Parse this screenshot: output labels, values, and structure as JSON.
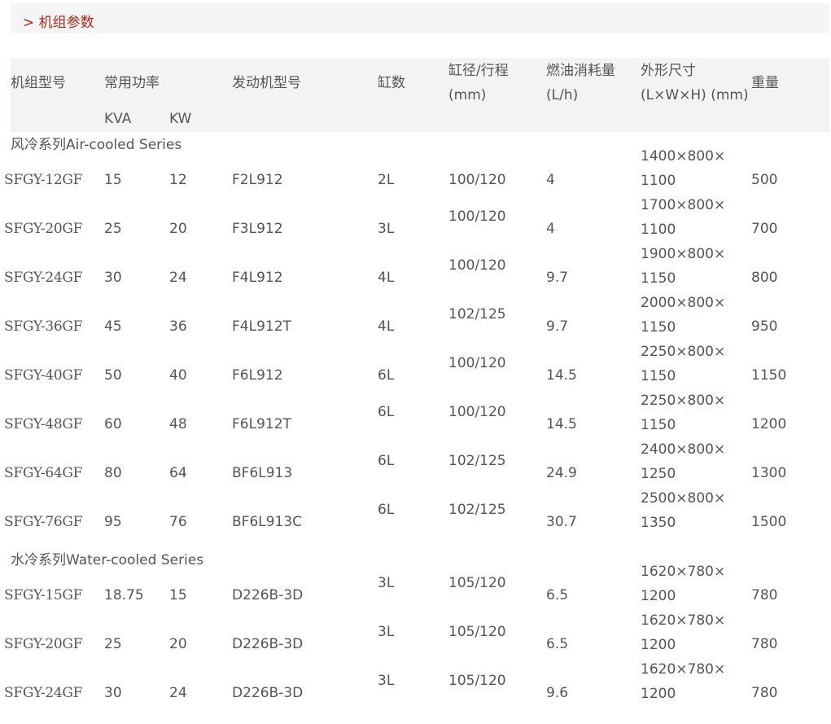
{
  "section": {
    "title": "> 机组参数"
  },
  "headers": {
    "model": "机组型号",
    "power": "常用功率",
    "kva": "KVA",
    "kw": "KW",
    "engine": "发动机型号",
    "cylinders": "缸数",
    "bore_line1": "缸径/行程",
    "bore_line2": "(mm)",
    "fuel_line1": "燃油消耗量",
    "fuel_line2": "(L/h)",
    "dim_line1": "外形尺寸",
    "dim_line2": "(L×W×H) (mm)",
    "weight": "重量"
  },
  "groups": [
    {
      "title": "风冷系列Air-cooled Series",
      "rows": [
        {
          "model": "SFGY-12GF",
          "kva": "15",
          "kw": "12",
          "engine": "F2L912",
          "cyl": "2L",
          "bore": "100/120",
          "fuel": "4",
          "dim1": "1400×800×",
          "dim2": "1100",
          "weight": "500"
        },
        {
          "model": "SFGY-20GF",
          "kva": "25",
          "kw": "20",
          "engine": "F3L912",
          "cyl": "3L",
          "bore": "100/120",
          "fuel": "4",
          "dim1": "1700×800×",
          "dim2": "1100",
          "weight": "700"
        },
        {
          "model": "SFGY-24GF",
          "kva": "30",
          "kw": "24",
          "engine": "F4L912",
          "cyl": "4L",
          "bore": "100/120",
          "fuel": "9.7",
          "dim1": "1900×800×",
          "dim2": "1150",
          "weight": "800"
        },
        {
          "model": "SFGY-36GF",
          "kva": "45",
          "kw": "36",
          "engine": "F4L912T",
          "cyl": "4L",
          "bore": "102/125",
          "fuel": "9.7",
          "dim1": "2000×800×",
          "dim2": "1150",
          "weight": "950"
        },
        {
          "model": "SFGY-40GF",
          "kva": "50",
          "kw": "40",
          "engine": "F6L912",
          "cyl": "6L",
          "bore": "100/120",
          "fuel": "14.5",
          "dim1": "2250×800×",
          "dim2": "1150",
          "weight": "1150"
        },
        {
          "model": "SFGY-48GF",
          "kva": "60",
          "kw": "48",
          "engine": "F6L912T",
          "cyl": "6L",
          "bore": "100/120",
          "fuel": "14.5",
          "dim1": "2250×800×",
          "dim2": "1150",
          "weight": "1200"
        },
        {
          "model": "SFGY-64GF",
          "kva": "80",
          "kw": "64",
          "engine": "BF6L913",
          "cyl": "6L",
          "bore": "102/125",
          "fuel": "24.9",
          "dim1": "2400×800×",
          "dim2": "1250",
          "weight": "1300"
        },
        {
          "model": "SFGY-76GF",
          "kva": "95",
          "kw": "76",
          "engine": "BF6L913C",
          "cyl": "6L",
          "bore": "102/125",
          "fuel": "30.7",
          "dim1": "2500×800×",
          "dim2": "1350",
          "weight": "1500"
        }
      ]
    },
    {
      "title": "水冷系列Water-cooled Series",
      "rows": [
        {
          "model": "SFGY-15GF",
          "kva": "18.75",
          "kw": "15",
          "engine": "D226B-3D",
          "cyl": "3L",
          "bore": "105/120",
          "fuel": "6.5",
          "dim1": "1620×780×",
          "dim2": "1200",
          "weight": "780"
        },
        {
          "model": "SFGY-20GF",
          "kva": "25",
          "kw": "20",
          "engine": "D226B-3D",
          "cyl": "3L",
          "bore": "105/120",
          "fuel": "6.5",
          "dim1": "1620×780×",
          "dim2": "1200",
          "weight": "780"
        },
        {
          "model": "SFGY-24GF",
          "kva": "30",
          "kw": "24",
          "engine": "D226B-3D",
          "cyl": "3L",
          "bore": "105/120",
          "fuel": "9.6",
          "dim1": "1620×780×",
          "dim2": "1200",
          "weight": "780"
        }
      ]
    }
  ]
}
